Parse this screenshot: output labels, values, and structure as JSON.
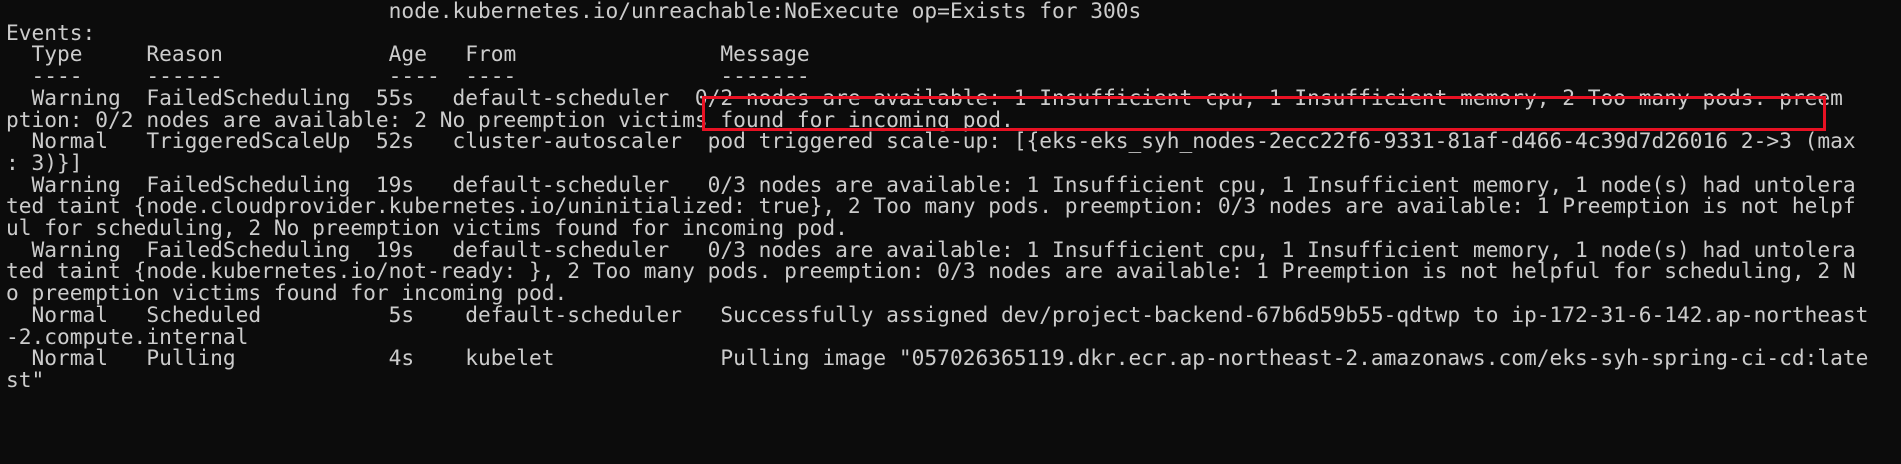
{
  "terminal": {
    "lines": [
      "                              node.kubernetes.io/unreachable:NoExecute op=Exists for 300s",
      "Events:",
      "  Type     Reason             Age   From                Message",
      "  ----     ------             ----  ----                -------",
      "  Warning  FailedScheduling  55s   default-scheduler  0/2 nodes are available: 1 Insufficient cpu, 1 Insufficient memory, 2 Too many pods. preem",
      "ption: 0/2 nodes are available: 2 No preemption victims found for incoming pod.",
      "  Normal   TriggeredScaleUp  52s   cluster-autoscaler  pod triggered scale-up: [{eks-eks_syh_nodes-2ecc22f6-9331-81af-d466-4c39d7d26016 2->3 (max",
      ": 3)}]",
      "  Warning  FailedScheduling  19s   default-scheduler   0/3 nodes are available: 1 Insufficient cpu, 1 Insufficient memory, 1 node(s) had untolera",
      "ted taint {node.cloudprovider.kubernetes.io/uninitialized: true}, 2 Too many pods. preemption: 0/3 nodes are available: 1 Preemption is not helpf",
      "ul for scheduling, 2 No preemption victims found for incoming pod.",
      "  Warning  FailedScheduling  19s   default-scheduler   0/3 nodes are available: 1 Insufficient cpu, 1 Insufficient memory, 1 node(s) had untolera",
      "ted taint {node.kubernetes.io/not-ready: }, 2 Too many pods. preemption: 0/3 nodes are available: 1 Preemption is not helpful for scheduling, 2 N",
      "o preemption victims found for incoming pod.",
      "  Normal   Scheduled          5s    default-scheduler   Successfully assigned dev/project-backend-67b6d59b55-qdtwp to ip-172-31-6-142.ap-northeast",
      "-2.compute.internal",
      "  Normal   Pulling            4s    kubelet             Pulling image \"057026365119.dkr.ecr.ap-northeast-2.amazonaws.com/eks-syh-spring-ci-cd:late",
      "st\""
    ]
  }
}
